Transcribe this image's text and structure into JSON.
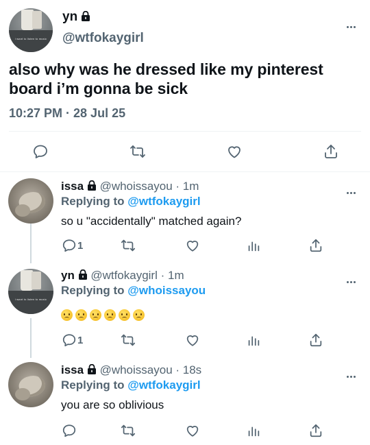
{
  "main_tweet": {
    "name": "yn",
    "handle": "@wtfokaygirl",
    "text": "also why was he dressed like my pinterest board i’m gonna be sick",
    "timestamp": "10:27 PM · 28 Jul 25",
    "avatar_caption": "i want to listen to music"
  },
  "replies": [
    {
      "name": "issa",
      "handle": "@whoissayou",
      "time": "· 1m",
      "replying_label": "Replying to",
      "replying_to": "@wtfokaygirl",
      "text": "so u \"accidentally\" matched again?",
      "reply_count": "1"
    },
    {
      "name": "yn",
      "handle": "@wtfokaygirl",
      "time": "· 1m",
      "replying_label": "Replying to",
      "replying_to": "@whoissayou",
      "emoji_name": "slightly-frowning-face",
      "emoji_count": 6,
      "reply_count": "1",
      "avatar_caption": "i want to listen to music"
    },
    {
      "name": "issa",
      "handle": "@whoissayou",
      "time": "· 18s",
      "replying_label": "Replying to",
      "replying_to": "@wtfokaygirl",
      "text": "you are so oblivious"
    }
  ],
  "colors": {
    "text": "#0f1419",
    "secondary": "#536471",
    "mention": "#1d9bf0",
    "divider": "#eff3f4"
  }
}
